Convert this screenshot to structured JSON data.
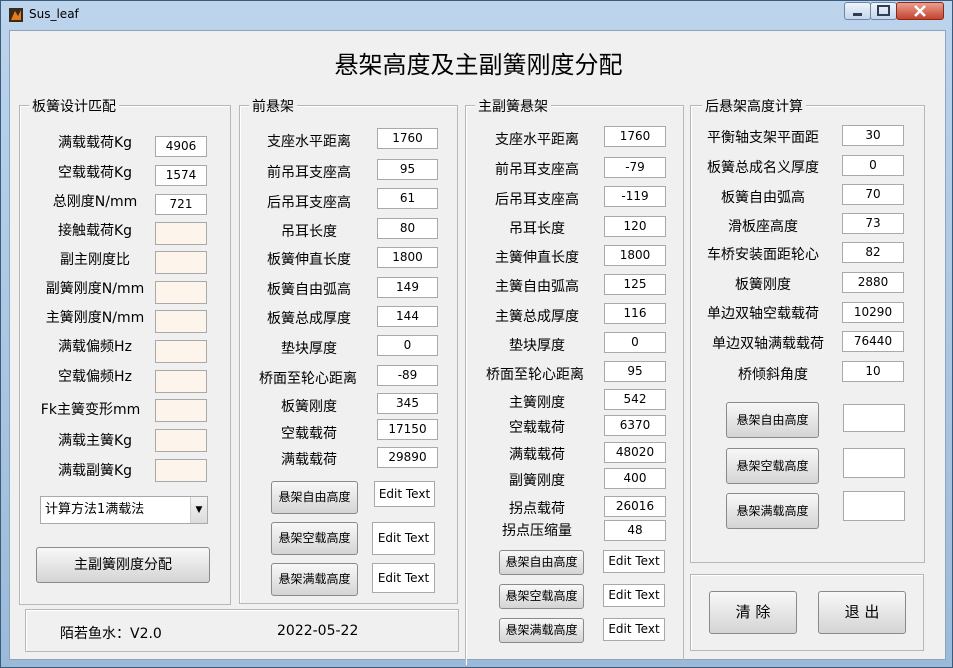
{
  "window": {
    "title": "Sus_leaf"
  },
  "main_title": "悬架高度及主副簧刚度分配",
  "panel1": {
    "title": "板簧设计匹配",
    "rows": [
      {
        "label": "满载载荷Kg",
        "value": "4906"
      },
      {
        "label": "空载载荷Kg",
        "value": "1574"
      },
      {
        "label": "总刚度N/mm",
        "value": "721"
      },
      {
        "label": "接触载荷Kg",
        "value": ""
      },
      {
        "label": "副主刚度比",
        "value": ""
      },
      {
        "label": "副簧刚度N/mm",
        "value": ""
      },
      {
        "label": "主簧刚度N/mm",
        "value": ""
      },
      {
        "label": "满载偏频Hz",
        "value": ""
      },
      {
        "label": "空载偏频Hz",
        "value": ""
      },
      {
        "label": "Fk主簧变形mm",
        "value": ""
      },
      {
        "label": "满载主簧Kg",
        "value": ""
      },
      {
        "label": "满载副簧Kg",
        "value": ""
      }
    ],
    "method_select": "计算方法1满载法",
    "action_button": "主副簧刚度分配"
  },
  "panel2": {
    "title": "前悬架",
    "rows": [
      {
        "label": "支座水平距离",
        "value": "1760"
      },
      {
        "label": "前吊耳支座高",
        "value": "95"
      },
      {
        "label": "后吊耳支座高",
        "value": "61"
      },
      {
        "label": "吊耳长度",
        "value": "80"
      },
      {
        "label": "板簧伸直长度",
        "value": "1800"
      },
      {
        "label": "板簧自由弧高",
        "value": "149"
      },
      {
        "label": "板簧总成厚度",
        "value": "144"
      },
      {
        "label": "垫块厚度",
        "value": "0"
      },
      {
        "label": "桥面至轮心距离",
        "value": "-89"
      },
      {
        "label": "板簧刚度",
        "value": "345"
      },
      {
        "label": "空载载荷",
        "value": "17150"
      },
      {
        "label": "满载载荷",
        "value": "29890"
      }
    ],
    "buttons": [
      "悬架自由高度",
      "悬架空载高度",
      "悬架满载高度"
    ],
    "outputs": [
      "Edit Text",
      "Edit Text",
      "Edit Text"
    ]
  },
  "panel3": {
    "title": "主副簧悬架",
    "rows": [
      {
        "label": "支座水平距离",
        "value": "1760"
      },
      {
        "label": "前吊耳支座高",
        "value": "-79"
      },
      {
        "label": "后吊耳支座高",
        "value": "-119"
      },
      {
        "label": "吊耳长度",
        "value": "120"
      },
      {
        "label": "主簧伸直长度",
        "value": "1800"
      },
      {
        "label": "主簧自由弧高",
        "value": "125"
      },
      {
        "label": "主簧总成厚度",
        "value": "116"
      },
      {
        "label": "垫块厚度",
        "value": "0"
      },
      {
        "label": "桥面至轮心距离",
        "value": "95"
      },
      {
        "label": "主簧刚度",
        "value": "542"
      },
      {
        "label": "空载载荷",
        "value": "6370"
      },
      {
        "label": "满载载荷",
        "value": "48020"
      },
      {
        "label": "副簧刚度",
        "value": "400"
      },
      {
        "label": "拐点载荷",
        "value": "26016"
      },
      {
        "label": "拐点压缩量",
        "value": "48"
      }
    ],
    "buttons": [
      "悬架自由高度",
      "悬架空载高度",
      "悬架满载高度"
    ],
    "outputs": [
      "Edit Text",
      "Edit Text",
      "Edit Text"
    ]
  },
  "panel4": {
    "title": "后悬架高度计算",
    "rows": [
      {
        "label": "平衡轴支架平面距",
        "value": "30"
      },
      {
        "label": "板簧总成名义厚度",
        "value": "0"
      },
      {
        "label": "板簧自由弧高",
        "value": "70"
      },
      {
        "label": "滑板座高度",
        "value": "73"
      },
      {
        "label": "车桥安装面距轮心",
        "value": "82"
      },
      {
        "label": "板簧刚度",
        "value": "2880"
      },
      {
        "label": "单边双轴空载载荷",
        "value": "10290"
      },
      {
        "label": "单边双轴满载载荷",
        "value": "76440"
      },
      {
        "label": "桥倾斜角度",
        "value": "10"
      }
    ],
    "buttons": [
      "悬架自由高度",
      "悬架空载高度",
      "悬架满载高度"
    ],
    "outputs": [
      "",
      "",
      ""
    ]
  },
  "actions": {
    "clear": "清 除",
    "exit": "退 出"
  },
  "footer": {
    "author": "陌若鱼水：V2.0",
    "date": "2022-05-22"
  }
}
